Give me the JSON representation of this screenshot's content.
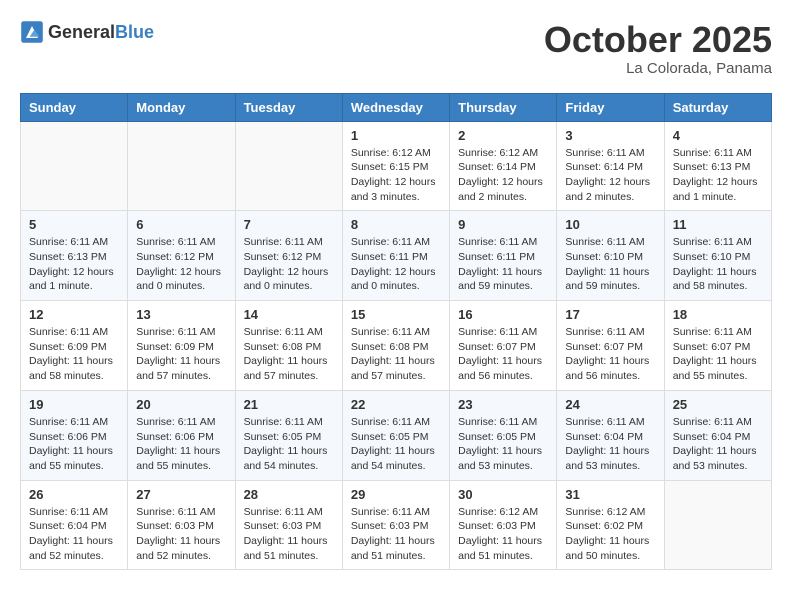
{
  "header": {
    "logo_general": "General",
    "logo_blue": "Blue",
    "month_title": "October 2025",
    "subtitle": "La Colorada, Panama"
  },
  "weekdays": [
    "Sunday",
    "Monday",
    "Tuesday",
    "Wednesday",
    "Thursday",
    "Friday",
    "Saturday"
  ],
  "weeks": [
    [
      {
        "day": "",
        "info": ""
      },
      {
        "day": "",
        "info": ""
      },
      {
        "day": "",
        "info": ""
      },
      {
        "day": "1",
        "info": "Sunrise: 6:12 AM\nSunset: 6:15 PM\nDaylight: 12 hours and 3 minutes."
      },
      {
        "day": "2",
        "info": "Sunrise: 6:12 AM\nSunset: 6:14 PM\nDaylight: 12 hours and 2 minutes."
      },
      {
        "day": "3",
        "info": "Sunrise: 6:11 AM\nSunset: 6:14 PM\nDaylight: 12 hours and 2 minutes."
      },
      {
        "day": "4",
        "info": "Sunrise: 6:11 AM\nSunset: 6:13 PM\nDaylight: 12 hours and 1 minute."
      }
    ],
    [
      {
        "day": "5",
        "info": "Sunrise: 6:11 AM\nSunset: 6:13 PM\nDaylight: 12 hours and 1 minute."
      },
      {
        "day": "6",
        "info": "Sunrise: 6:11 AM\nSunset: 6:12 PM\nDaylight: 12 hours and 0 minutes."
      },
      {
        "day": "7",
        "info": "Sunrise: 6:11 AM\nSunset: 6:12 PM\nDaylight: 12 hours and 0 minutes."
      },
      {
        "day": "8",
        "info": "Sunrise: 6:11 AM\nSunset: 6:11 PM\nDaylight: 12 hours and 0 minutes."
      },
      {
        "day": "9",
        "info": "Sunrise: 6:11 AM\nSunset: 6:11 PM\nDaylight: 11 hours and 59 minutes."
      },
      {
        "day": "10",
        "info": "Sunrise: 6:11 AM\nSunset: 6:10 PM\nDaylight: 11 hours and 59 minutes."
      },
      {
        "day": "11",
        "info": "Sunrise: 6:11 AM\nSunset: 6:10 PM\nDaylight: 11 hours and 58 minutes."
      }
    ],
    [
      {
        "day": "12",
        "info": "Sunrise: 6:11 AM\nSunset: 6:09 PM\nDaylight: 11 hours and 58 minutes."
      },
      {
        "day": "13",
        "info": "Sunrise: 6:11 AM\nSunset: 6:09 PM\nDaylight: 11 hours and 57 minutes."
      },
      {
        "day": "14",
        "info": "Sunrise: 6:11 AM\nSunset: 6:08 PM\nDaylight: 11 hours and 57 minutes."
      },
      {
        "day": "15",
        "info": "Sunrise: 6:11 AM\nSunset: 6:08 PM\nDaylight: 11 hours and 57 minutes."
      },
      {
        "day": "16",
        "info": "Sunrise: 6:11 AM\nSunset: 6:07 PM\nDaylight: 11 hours and 56 minutes."
      },
      {
        "day": "17",
        "info": "Sunrise: 6:11 AM\nSunset: 6:07 PM\nDaylight: 11 hours and 56 minutes."
      },
      {
        "day": "18",
        "info": "Sunrise: 6:11 AM\nSunset: 6:07 PM\nDaylight: 11 hours and 55 minutes."
      }
    ],
    [
      {
        "day": "19",
        "info": "Sunrise: 6:11 AM\nSunset: 6:06 PM\nDaylight: 11 hours and 55 minutes."
      },
      {
        "day": "20",
        "info": "Sunrise: 6:11 AM\nSunset: 6:06 PM\nDaylight: 11 hours and 55 minutes."
      },
      {
        "day": "21",
        "info": "Sunrise: 6:11 AM\nSunset: 6:05 PM\nDaylight: 11 hours and 54 minutes."
      },
      {
        "day": "22",
        "info": "Sunrise: 6:11 AM\nSunset: 6:05 PM\nDaylight: 11 hours and 54 minutes."
      },
      {
        "day": "23",
        "info": "Sunrise: 6:11 AM\nSunset: 6:05 PM\nDaylight: 11 hours and 53 minutes."
      },
      {
        "day": "24",
        "info": "Sunrise: 6:11 AM\nSunset: 6:04 PM\nDaylight: 11 hours and 53 minutes."
      },
      {
        "day": "25",
        "info": "Sunrise: 6:11 AM\nSunset: 6:04 PM\nDaylight: 11 hours and 53 minutes."
      }
    ],
    [
      {
        "day": "26",
        "info": "Sunrise: 6:11 AM\nSunset: 6:04 PM\nDaylight: 11 hours and 52 minutes."
      },
      {
        "day": "27",
        "info": "Sunrise: 6:11 AM\nSunset: 6:03 PM\nDaylight: 11 hours and 52 minutes."
      },
      {
        "day": "28",
        "info": "Sunrise: 6:11 AM\nSunset: 6:03 PM\nDaylight: 11 hours and 51 minutes."
      },
      {
        "day": "29",
        "info": "Sunrise: 6:11 AM\nSunset: 6:03 PM\nDaylight: 11 hours and 51 minutes."
      },
      {
        "day": "30",
        "info": "Sunrise: 6:12 AM\nSunset: 6:03 PM\nDaylight: 11 hours and 51 minutes."
      },
      {
        "day": "31",
        "info": "Sunrise: 6:12 AM\nSunset: 6:02 PM\nDaylight: 11 hours and 50 minutes."
      },
      {
        "day": "",
        "info": ""
      }
    ]
  ]
}
